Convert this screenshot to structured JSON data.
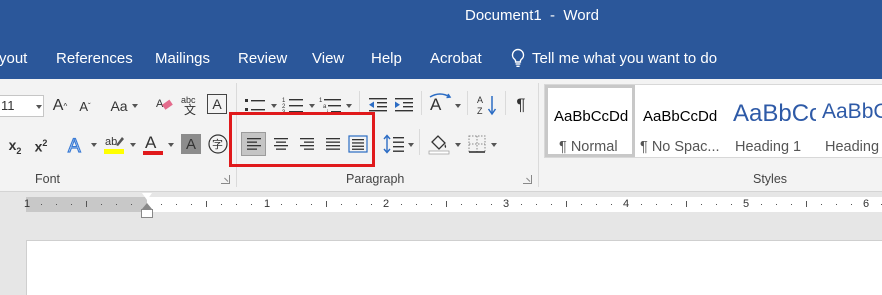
{
  "title_bar": {
    "title": "Document1  -  Word"
  },
  "menu": {
    "tabs": [
      "yout",
      "References",
      "Mailings",
      "Review",
      "View",
      "Help",
      "Acrobat"
    ],
    "tell_me": "Tell me what you want to do"
  },
  "font_group": {
    "font_size_value": "11",
    "label": "Font",
    "change_case_label": "Aa",
    "grow_font_label": "A",
    "shrink_font_label": "A",
    "subscript_label": "x2",
    "superscript_label": "x2"
  },
  "paragraph_group": {
    "label": "Paragraph"
  },
  "styles_group": {
    "label": "Styles",
    "items": [
      {
        "sample": "AaBbCcDd",
        "name": "¶ Normal",
        "selected": true
      },
      {
        "sample": "AaBbCcDd",
        "name": "¶ No Spac...",
        "selected": false
      },
      {
        "sample": "AaBbCc",
        "name": "Heading 1",
        "selected": false
      },
      {
        "sample": "AaBbCc",
        "name": "Heading",
        "selected": false
      }
    ]
  },
  "ruler": {
    "numbers": [
      "1",
      "1",
      "2",
      "3",
      "4",
      "5",
      "6"
    ]
  },
  "colors": {
    "title_bar": "#2b579a",
    "highlight_box": "#e0191b",
    "font_color": "#e0191b",
    "highlight_color": "#ffff00",
    "heading_style": "#2e5aa7"
  }
}
